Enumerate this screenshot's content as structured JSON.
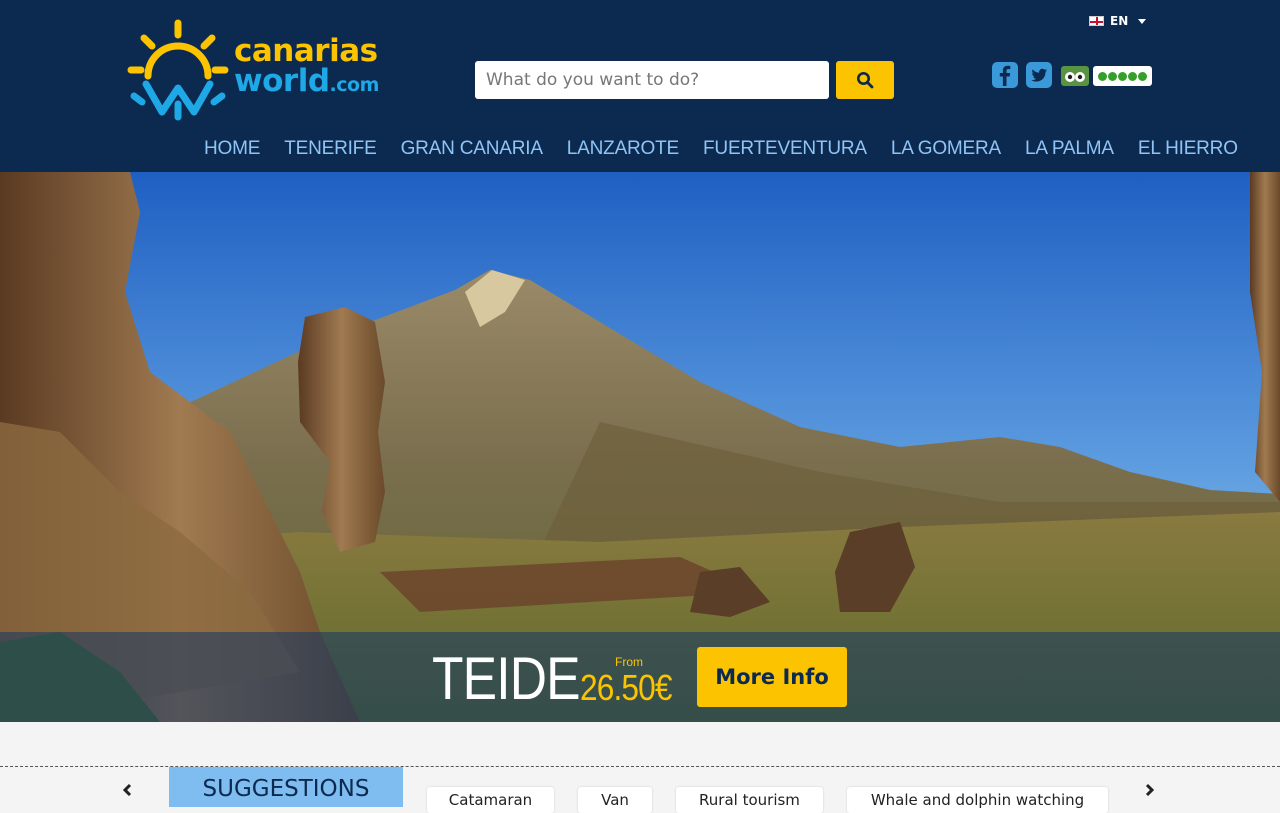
{
  "header": {
    "logo": {
      "line1": "canarias",
      "line2": "world",
      "suffix": ".com"
    },
    "language": {
      "selected": "EN"
    },
    "search": {
      "placeholder": "What do you want to do?",
      "value": ""
    }
  },
  "nav": {
    "items": [
      "HOME",
      "TENERIFE",
      "GRAN CANARIA",
      "LANZAROTE",
      "FUERTEVENTURA",
      "LA GOMERA",
      "LA PALMA",
      "EL HIERRO"
    ]
  },
  "hero": {
    "title": "TEIDE",
    "from_label": "From",
    "price": "26.50€",
    "button_label": "More Info"
  },
  "suggestions": {
    "label": "SUGGESTIONS",
    "chips": [
      "Catamaran",
      "Van",
      "Rural tourism",
      "Whale and dolphin watching"
    ]
  },
  "colors": {
    "header_bg": "#0c2a50",
    "accent_yellow": "#fcc400",
    "accent_blue": "#1ea8e6",
    "nav_text": "#8fc4f5",
    "suggestions_bg": "#7fbcef"
  },
  "icons": [
    "sun-logo-icon",
    "search-icon",
    "facebook-icon",
    "twitter-icon",
    "tripadvisor-icon",
    "tripadvisor-rating-icon",
    "uk-flag-icon",
    "chevron-left-icon",
    "chevron-right-icon"
  ]
}
